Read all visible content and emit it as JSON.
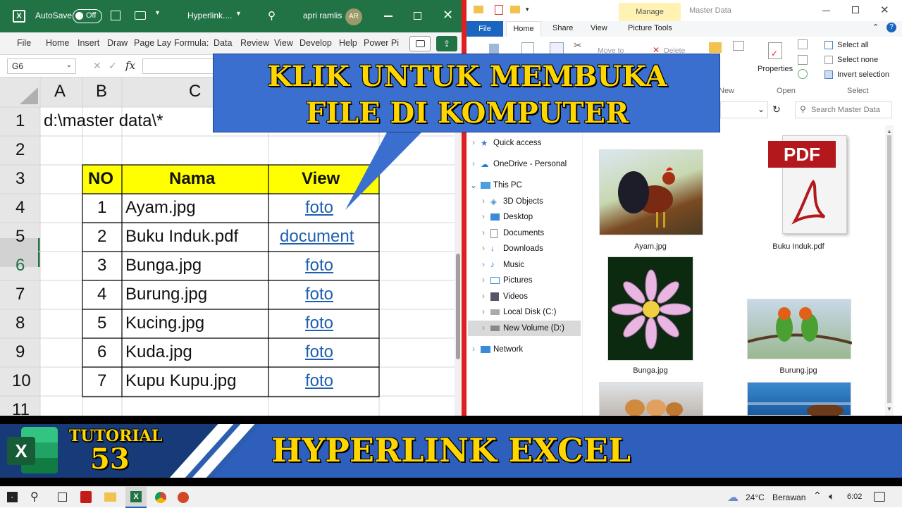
{
  "excel": {
    "autosave_label": "AutoSave",
    "autosave_state": "Off",
    "doc_title": "Hyperlink....",
    "user_name": "apri ramlis",
    "user_initials": "AR",
    "ribbon_tabs": [
      "File",
      "Home",
      "Insert",
      "Draw",
      "Page Lay",
      "Formula:",
      "Data",
      "Review",
      "View",
      "Develop",
      "Help",
      "Power Pi"
    ],
    "name_box": "G6",
    "fx_label": "fx",
    "columns": [
      "A",
      "B",
      "C"
    ],
    "rows": [
      "1",
      "2",
      "3",
      "4",
      "5",
      "6",
      "7",
      "8",
      "9",
      "10",
      "11"
    ],
    "a1_value": "d:\\master data\\*",
    "table_headers": [
      "NO",
      "Nama",
      "View"
    ],
    "table_rows": [
      {
        "no": "1",
        "name": "Ayam.jpg",
        "link": "foto"
      },
      {
        "no": "2",
        "name": "Buku Induk.pdf",
        "link": "document"
      },
      {
        "no": "3",
        "name": "Bunga.jpg",
        "link": "foto"
      },
      {
        "no": "4",
        "name": "Burung.jpg",
        "link": "foto"
      },
      {
        "no": "5",
        "name": "Kucing.jpg",
        "link": "foto"
      },
      {
        "no": "6",
        "name": "Kuda.jpg",
        "link": "foto"
      },
      {
        "no": "7",
        "name": "Kupu Kupu.jpg",
        "link": "foto"
      }
    ]
  },
  "callout": {
    "line1": "KLIK UNTUK MEMBUKA",
    "line2": "FILE DI KOMPUTER"
  },
  "explorer": {
    "manage_label": "Manage",
    "window_title": "Master Data",
    "ribbon_tabs": [
      "File",
      "Home",
      "Share",
      "View",
      "Picture Tools"
    ],
    "group_select": [
      "Select all",
      "Select none",
      "Invert selection"
    ],
    "group_labels": {
      "properties": "Properties",
      "open": "Open",
      "select": "Select",
      "new": "New",
      "move_to": "Move to",
      "delete": "Delete"
    },
    "search_placeholder": "Search Master Data",
    "nav": {
      "quick_access": "Quick access",
      "onedrive": "OneDrive - Personal",
      "this_pc": "This PC",
      "children": [
        "3D Objects",
        "Desktop",
        "Documents",
        "Downloads",
        "Music",
        "Pictures",
        "Videos",
        "Local Disk (C:)",
        "New Volume (D:)"
      ],
      "network": "Network"
    },
    "files": [
      "Ayam.jpg",
      "Buku Induk.pdf",
      "Bunga.jpg",
      "Burung.jpg"
    ],
    "pdf_badge": "PDF"
  },
  "banner": {
    "tutorial_label": "TUTORIAL",
    "tutorial_number": "53",
    "headline": "HYPERLINK EXCEL"
  },
  "taskbar": {
    "temperature": "24°C",
    "weather": "Berawan",
    "time": "6:02"
  },
  "colors": {
    "excel_green": "#217346",
    "header_yellow": "#ffff00",
    "banner_blue": "#2d5db0",
    "callout_blue": "#3a6fd0",
    "title_yellow": "#ffd600"
  }
}
